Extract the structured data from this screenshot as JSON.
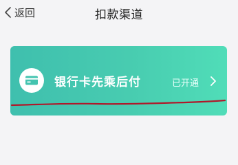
{
  "nav": {
    "back_label": "返回",
    "back_icon": "chevron-left-icon",
    "title": "扣款渠道"
  },
  "channel_card": {
    "icon": "bank-card-icon",
    "label": "银行卡先乘后付",
    "status": "已开通",
    "arrow_icon": "chevron-right-icon",
    "gradient_colors": [
      "#3fbfae",
      "#50ddb8"
    ]
  },
  "annotation": {
    "color": "#b0182a",
    "type": "red-underline"
  }
}
